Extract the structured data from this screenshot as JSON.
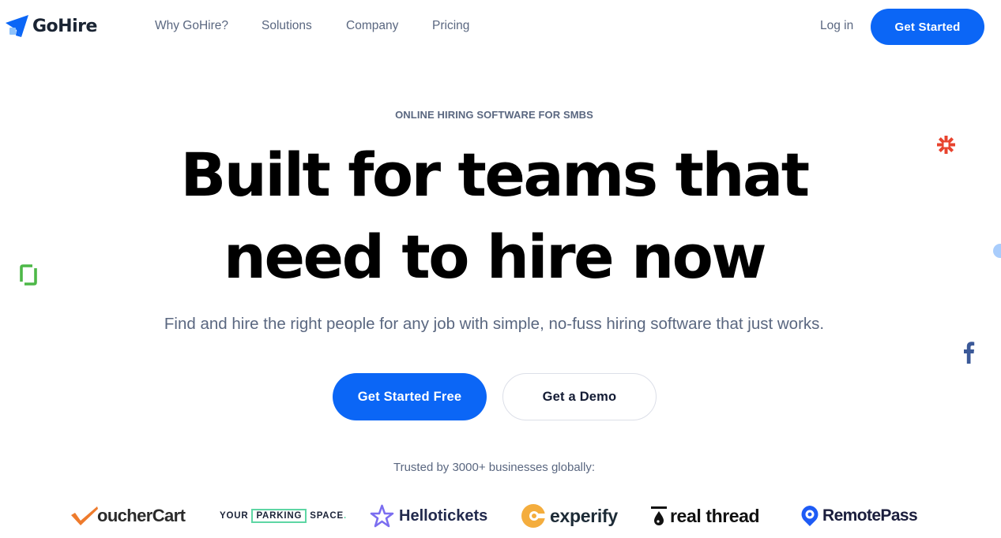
{
  "header": {
    "brand": "GoHire",
    "nav": [
      {
        "label": "Why GoHire?"
      },
      {
        "label": "Solutions"
      },
      {
        "label": "Company"
      },
      {
        "label": "Pricing"
      }
    ],
    "login_label": "Log in",
    "get_started_label": "Get Started"
  },
  "hero": {
    "eyebrow": "ONLINE HIRING SOFTWARE FOR SMBS",
    "headline_line1": "Built for teams that",
    "headline_line2": "need to hire now",
    "subhead": "Find and hire the right people for any job with simple, no-fuss hiring software that just works.",
    "cta_primary": "Get Started Free",
    "cta_secondary": "Get a Demo",
    "trusted": "Trusted by 3000+ businesses globally:"
  },
  "customer_logos": [
    {
      "name": "VoucherCart",
      "text": "oucherCart"
    },
    {
      "name": "Your Parking Space",
      "part1": "YOUR",
      "part2": "PARKING",
      "part3": "SPACE",
      "dot": "."
    },
    {
      "name": "Hellotickets",
      "text": "Hellotickets"
    },
    {
      "name": "experify",
      "text": "experify"
    },
    {
      "name": "real thread",
      "text": "real thread"
    },
    {
      "name": "RemotePass",
      "text": "RemotePass"
    }
  ],
  "floating_icons": [
    {
      "name": "zapier-icon",
      "color": "#e8432e"
    },
    {
      "name": "glassdoor-icon",
      "color": "#4db848"
    },
    {
      "name": "facebook-icon",
      "color": "#3b5998"
    },
    {
      "name": "blue-circle",
      "color": "#a9cdfc"
    }
  ],
  "colors": {
    "primary": "#0b66f6",
    "text_muted": "#5a6780",
    "headline": "#000000"
  }
}
